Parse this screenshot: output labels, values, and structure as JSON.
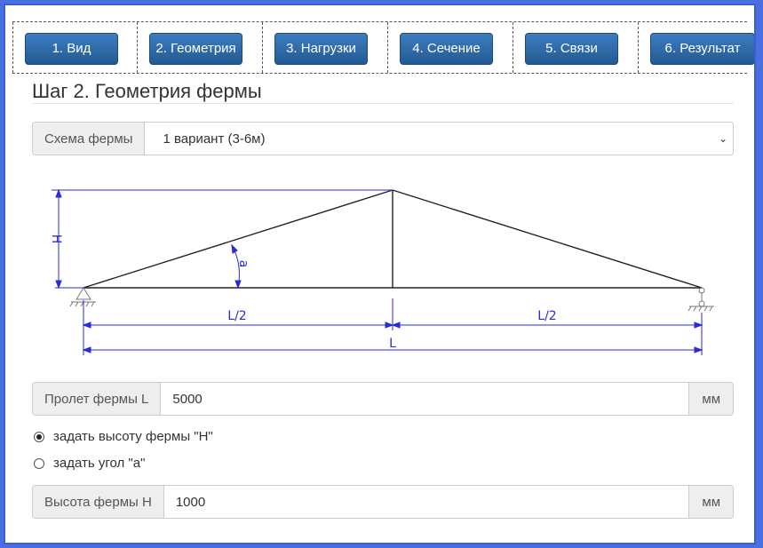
{
  "nav": {
    "buttons": [
      {
        "label": "1. Вид"
      },
      {
        "label": "2. Геометрия"
      },
      {
        "label": "3. Нагрузки"
      },
      {
        "label": "4. Сечение"
      },
      {
        "label": "5. Связи"
      },
      {
        "label": "6. Результат"
      }
    ]
  },
  "page": {
    "title": "Шаг 2. Геометрия фермы"
  },
  "scheme": {
    "label": "Схема фермы",
    "selected": "1 вариант (3-6м)"
  },
  "diagram": {
    "label_H": "H",
    "label_a": "a",
    "label_half_left": "L/2",
    "label_half_right": "L/2",
    "label_L": "L"
  },
  "span": {
    "label": "Пролет фермы L",
    "value": "5000",
    "unit": "мм"
  },
  "mode": {
    "option_height": "задать высоту фермы \"H\"",
    "option_angle": "задать угол \"a\"",
    "selected": "height"
  },
  "height": {
    "label": "Высота фермы H",
    "value": "1000",
    "unit": "мм"
  }
}
